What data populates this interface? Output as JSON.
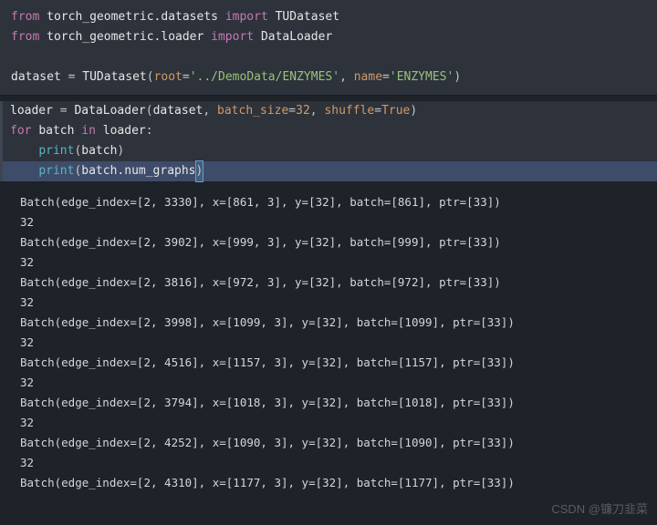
{
  "code_top": {
    "l1": {
      "pre": "from ",
      "mod": "torch_geometric.datasets ",
      "imp": "import ",
      "name": "TUDataset"
    },
    "l2": {
      "pre": "from ",
      "mod": "torch_geometric.loader ",
      "imp": "import ",
      "name": "DataLoader"
    },
    "l3": {
      "lhs": "dataset ",
      "eq": "= ",
      "fn": "TUDataset",
      "lp": "(",
      "p1": "root",
      "eq1": "=",
      "s1": "'../DemoData/ENZYMES'",
      "c1": ", ",
      "p2": "name",
      "eq2": "=",
      "s2": "'ENZYMES'",
      "rp": ")"
    }
  },
  "code_mid": {
    "l1": {
      "lhs": "loader ",
      "eq": "= ",
      "fn": "DataLoader",
      "lp": "(",
      "a1": "dataset",
      "c1": ", ",
      "p1": "batch_size",
      "eq1": "=",
      "n1": "32",
      "c2": ", ",
      "p2": "shuffle",
      "eq2": "=",
      "b1": "True",
      "rp": ")"
    },
    "l2": {
      "for": "for ",
      "var": "batch ",
      "in": "in ",
      "iter": "loader",
      "col": ":"
    },
    "l3": {
      "indent": "    ",
      "fn": "print",
      "lp": "(",
      "arg": "batch",
      "rp": ")"
    },
    "l4": {
      "indent": "    ",
      "fn": "print",
      "lp": "(",
      "arg": "batch.num_graphs",
      "rp": ")"
    }
  },
  "output": [
    "Batch(edge_index=[2, 3330], x=[861, 3], y=[32], batch=[861], ptr=[33])",
    "32",
    "Batch(edge_index=[2, 3902], x=[999, 3], y=[32], batch=[999], ptr=[33])",
    "32",
    "Batch(edge_index=[2, 3816], x=[972, 3], y=[32], batch=[972], ptr=[33])",
    "32",
    "Batch(edge_index=[2, 3998], x=[1099, 3], y=[32], batch=[1099], ptr=[33])",
    "32",
    "Batch(edge_index=[2, 4516], x=[1157, 3], y=[32], batch=[1157], ptr=[33])",
    "32",
    "Batch(edge_index=[2, 3794], x=[1018, 3], y=[32], batch=[1018], ptr=[33])",
    "32",
    "Batch(edge_index=[2, 4252], x=[1090, 3], y=[32], batch=[1090], ptr=[33])",
    "32",
    "Batch(edge_index=[2, 4310], x=[1177, 3], y=[32], batch=[1177], ptr=[33])"
  ],
  "watermark": "CSDN @镰刀韭菜"
}
